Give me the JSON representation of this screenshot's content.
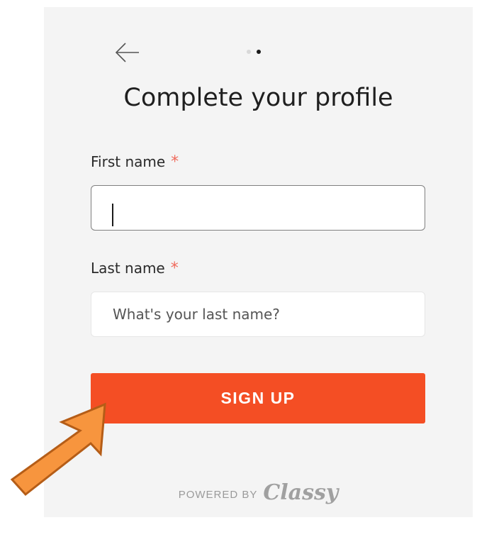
{
  "progress": {
    "total_steps": 2,
    "current_step": 2
  },
  "title": "Complete your profile",
  "fields": {
    "first_name": {
      "label": "First name",
      "required_mark": "*",
      "value": "",
      "placeholder": ""
    },
    "last_name": {
      "label": "Last name",
      "required_mark": "*",
      "value": "",
      "placeholder": "What's your last name?"
    }
  },
  "actions": {
    "signup_label": "SIGN UP"
  },
  "footer": {
    "powered_by": "POWERED BY",
    "brand": "Classy"
  },
  "colors": {
    "accent": "#f44e24",
    "required": "#f06a5c",
    "card_bg": "#f4f4f4",
    "annotation_arrow": "#f7953e"
  },
  "icons": {
    "back": "arrow-left-icon",
    "annotation": "orange-pointer-arrow-icon"
  }
}
